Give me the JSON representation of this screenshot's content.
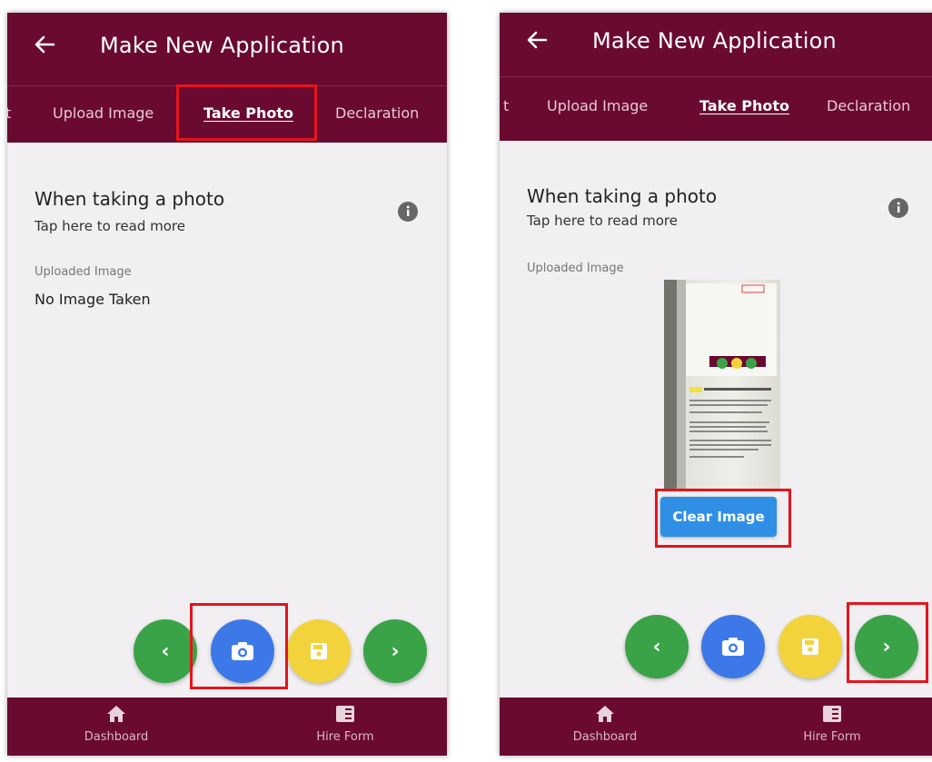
{
  "screens": [
    {
      "app_title": "Make New Application",
      "tabs": {
        "left_fragment": "t",
        "upload": "Upload Image",
        "take_photo": "Take Photo",
        "declaration": "Declaration"
      },
      "info": {
        "title": "When taking a photo",
        "subtitle": "Tap here to read more"
      },
      "uploaded_label": "Uploaded Image",
      "image_status": "No Image Taken",
      "nav": {
        "dashboard": "Dashboard",
        "hire_form": "Hire Form"
      }
    },
    {
      "app_title": "Make New Application",
      "tabs": {
        "left_fragment": "t",
        "upload": "Upload Image",
        "take_photo": "Take Photo",
        "declaration": "Declaration"
      },
      "info": {
        "title": "When taking a photo",
        "subtitle": "Tap here to read more"
      },
      "uploaded_label": "Uploaded Image",
      "clear_button": "Clear Image",
      "nav": {
        "dashboard": "Dashboard",
        "hire_form": "Hire Form"
      }
    }
  ],
  "colors": {
    "header": "#6a0a30",
    "background": "#f1eff1",
    "fab_green": "#3aa348",
    "fab_blue": "#3c78e8",
    "fab_yellow": "#f2d33c",
    "highlight": "#e6141c",
    "clear_button": "#2f8fe4"
  },
  "icons": [
    "back-arrow-icon",
    "info-icon",
    "chevron-left-icon",
    "camera-icon",
    "save-icon",
    "chevron-right-icon",
    "home-icon",
    "form-icon"
  ]
}
